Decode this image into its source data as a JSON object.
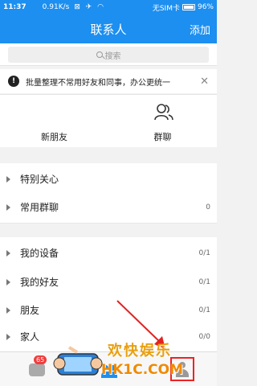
{
  "status": {
    "time": "11:37",
    "speed": "0.91K/s",
    "carrier": "无SIM卡",
    "battery": "96%"
  },
  "header": {
    "title": "联系人",
    "add_label": "添加"
  },
  "search": {
    "placeholder": "搜索"
  },
  "notice": {
    "text": "批量整理不常用好友和同事，办公更统一",
    "close": "✕"
  },
  "quick": {
    "new_friends": "新朋友",
    "group_chat": "群聊"
  },
  "groups": [
    {
      "name": "特别关心",
      "count": ""
    },
    {
      "name": "常用群聊",
      "count": "0"
    },
    {
      "name": "我的设备",
      "count": "0/1"
    },
    {
      "name": "我的好友",
      "count": "0/1"
    },
    {
      "name": "朋友",
      "count": "0/1"
    },
    {
      "name": "家人",
      "count": "0/0"
    }
  ],
  "tabbar": {
    "message_badge": "65"
  },
  "watermark": {
    "line1": "欢快娱乐",
    "line2": "HK1C.COM"
  },
  "colors": {
    "accent": "#1c8ff0",
    "badge": "#f23b3b",
    "highlight": "#e22222"
  }
}
